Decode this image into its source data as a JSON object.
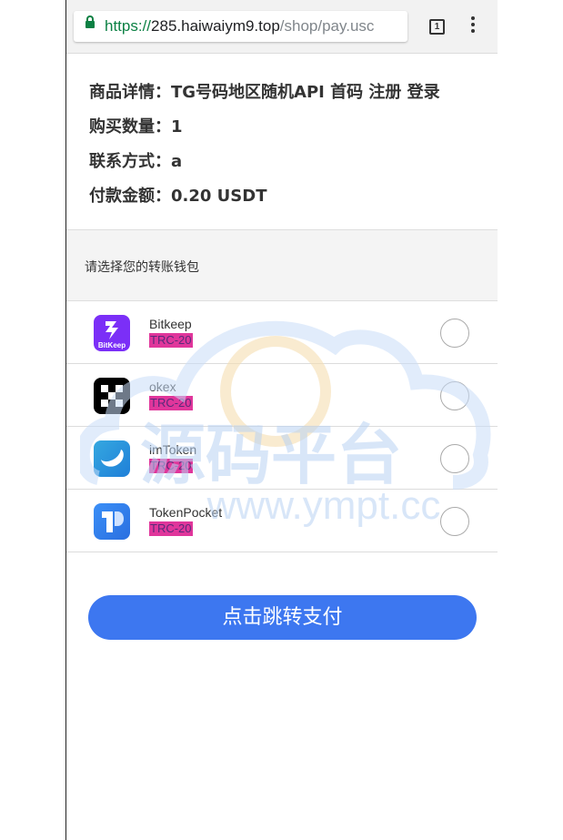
{
  "browser": {
    "url_scheme": "https://",
    "url_host": "285.haiwaiym9.top",
    "url_path": "/shop/pay.usc",
    "tab_count": "1"
  },
  "order": {
    "details": [
      "商品详情：TG号码地区随机API 首码 注册 登录",
      "购买数量：1",
      "联系方式：a",
      "付款金额：0.20 USDT"
    ]
  },
  "wallet_section": {
    "prompt": "请选择您的转账钱包",
    "wallets": [
      {
        "name": "Bitkeep",
        "network": "TRC-20",
        "icon": "bitkeep-icon",
        "icon_text": "BitKeep"
      },
      {
        "name": "okex",
        "network": "TRC-20",
        "icon": "okex-icon"
      },
      {
        "name": "imToken",
        "network": "TRC-20",
        "icon": "imtoken-icon"
      },
      {
        "name": "TokenPocket",
        "network": "TRC-20",
        "icon": "tokenpocket-icon"
      }
    ]
  },
  "watermark": {
    "title": "源码平台",
    "url": "www.ympt.cc"
  },
  "actions": {
    "pay_label": "点击跳转支付"
  },
  "colors": {
    "primary": "#3d77f0",
    "tag_bg": "#e0369b",
    "secure": "#0b8043"
  }
}
